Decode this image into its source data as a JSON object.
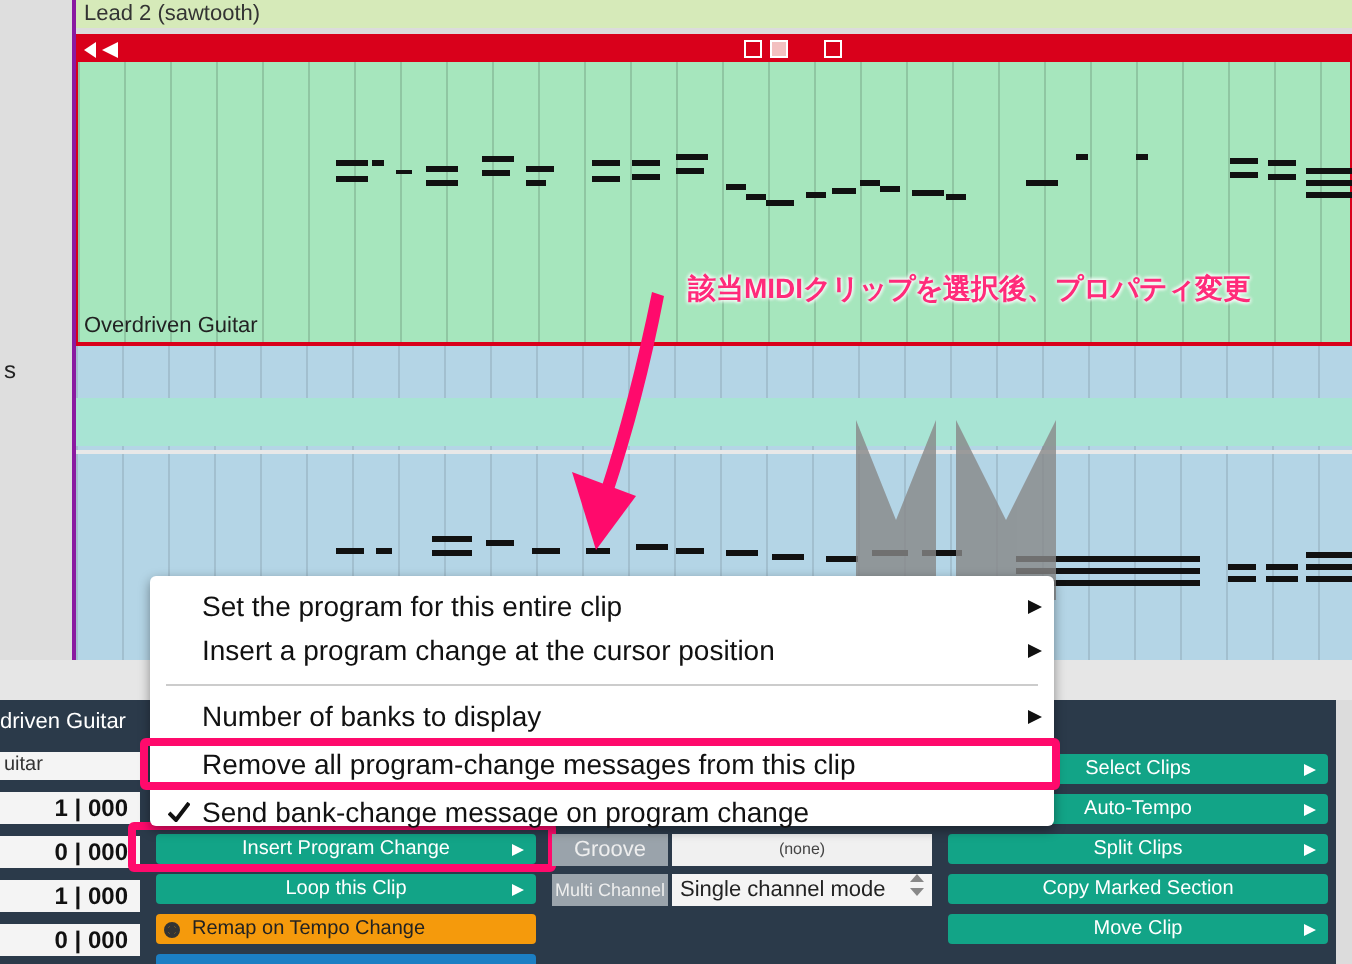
{
  "track_list": {
    "partial_name": "s"
  },
  "arrangement": {
    "upper_clip": {
      "name": "Lead 2 (sawtooth)"
    },
    "selected_clip": {
      "name": "Overdriven Guitar",
      "selected": true
    }
  },
  "annotation": {
    "text": "該当MIDIクリップを選択後、プロパティ変更"
  },
  "context_menu": {
    "items": [
      {
        "kind": "item",
        "label": "Set the program for this entire clip",
        "submenu": true,
        "checked": false,
        "highlighted": false
      },
      {
        "kind": "item",
        "label": "Insert a program change at the cursor position",
        "submenu": true,
        "checked": false,
        "highlighted": false
      },
      {
        "kind": "separator"
      },
      {
        "kind": "item",
        "label": "Number of banks to display",
        "submenu": true,
        "checked": false,
        "highlighted": false
      },
      {
        "kind": "item",
        "label": "Remove all program-change messages from this clip",
        "submenu": false,
        "checked": false,
        "highlighted": true
      },
      {
        "kind": "item",
        "label": "Send bank-change message on program change",
        "submenu": false,
        "checked": true,
        "highlighted": false
      }
    ]
  },
  "clip_panel": {
    "title": "driven Guitar",
    "name_field": "uitar",
    "position_fields": [
      "1 | 000",
      "0 | 000",
      "1 | 000",
      "0 | 000"
    ],
    "buttons": [
      {
        "kind": "teal",
        "label": "Insert Program Change",
        "submenu": true,
        "highlighted": true
      },
      {
        "kind": "teal",
        "label": "Loop this Clip",
        "submenu": true,
        "highlighted": false
      },
      {
        "kind": "orange",
        "label": "Remap on Tempo Change",
        "submenu": false,
        "highlighted": false
      }
    ],
    "groove": {
      "label": "Groove",
      "value": "(none)"
    },
    "multi_channel": {
      "label": "Multi Channel",
      "value": "Single channel mode"
    },
    "actions": [
      {
        "label": "Select Clips",
        "submenu": true
      },
      {
        "label": "Auto-Tempo",
        "submenu": true
      },
      {
        "label": "Split Clips",
        "submenu": true
      },
      {
        "label": "Copy Marked Section",
        "submenu": false
      },
      {
        "label": "Move Clip",
        "submenu": true
      }
    ]
  }
}
